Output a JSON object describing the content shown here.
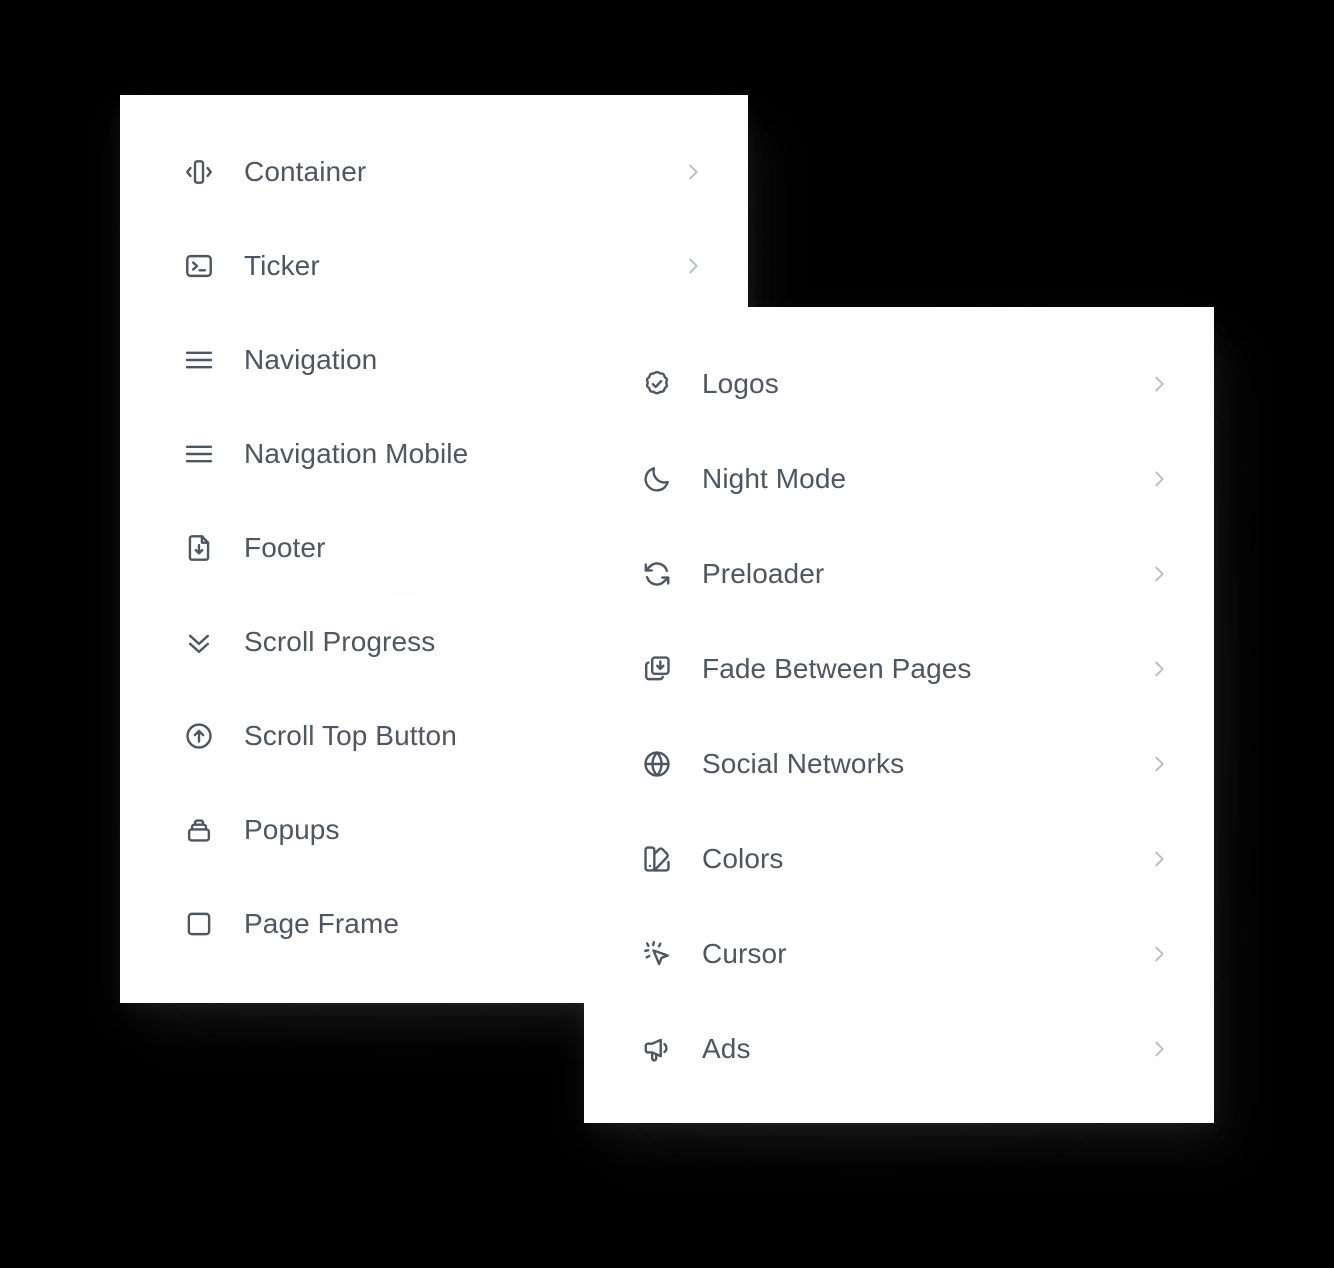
{
  "background_color": "#000000",
  "panel_color": "#ffffff",
  "text_color": "#4e5661",
  "icon_color": "#4e5661",
  "chevron_color": "#b6bcc4",
  "panels": [
    {
      "id": "left",
      "name": "site-elements-menu",
      "items": [
        {
          "label": "Container",
          "icon": "container-icon",
          "chevron": true
        },
        {
          "label": "Ticker",
          "icon": "terminal-icon",
          "chevron": true
        },
        {
          "label": "Navigation",
          "icon": "hamburger-menu-icon",
          "chevron": false
        },
        {
          "label": "Navigation Mobile",
          "icon": "hamburger-menu-icon",
          "chevron": false
        },
        {
          "label": "Footer",
          "icon": "file-download-icon",
          "chevron": false
        },
        {
          "label": "Scroll Progress",
          "icon": "chevrons-down-icon",
          "chevron": false
        },
        {
          "label": "Scroll Top Button",
          "icon": "arrow-up-circle-icon",
          "chevron": false
        },
        {
          "label": "Popups",
          "icon": "popup-stack-icon",
          "chevron": false
        },
        {
          "label": "Page Frame",
          "icon": "square-icon",
          "chevron": false
        }
      ]
    },
    {
      "id": "right",
      "name": "site-features-menu",
      "items": [
        {
          "label": "Logos",
          "icon": "badge-check-icon",
          "chevron": true
        },
        {
          "label": "Night Mode",
          "icon": "moon-icon",
          "chevron": true
        },
        {
          "label": "Preloader",
          "icon": "refresh-icon",
          "chevron": true
        },
        {
          "label": "Fade Between Pages",
          "icon": "layers-download-icon",
          "chevron": true
        },
        {
          "label": "Social Networks",
          "icon": "globe-icon",
          "chevron": true
        },
        {
          "label": "Colors",
          "icon": "color-swatch-icon",
          "chevron": true
        },
        {
          "label": "Cursor",
          "icon": "cursor-click-icon",
          "chevron": true
        },
        {
          "label": "Ads",
          "icon": "megaphone-icon",
          "chevron": true
        }
      ]
    }
  ],
  "chevron_icon": "chevron-right-icon"
}
